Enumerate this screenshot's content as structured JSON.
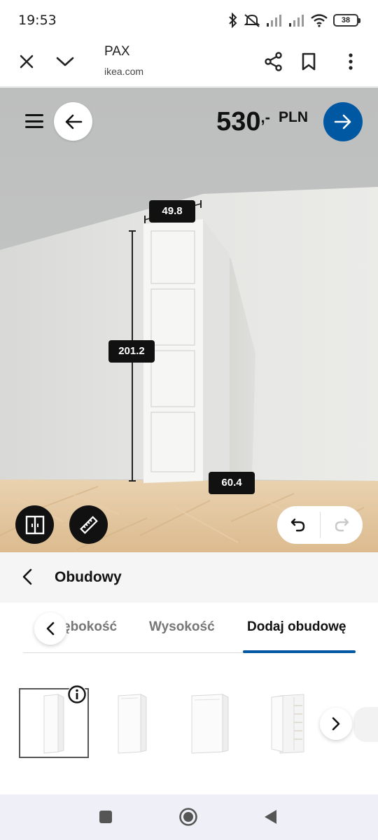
{
  "status_bar": {
    "time": "19:53",
    "battery": "38",
    "icons": [
      "bluetooth-icon",
      "mute-icon",
      "signal-icon",
      "signal-icon",
      "wifi-icon",
      "battery-icon"
    ]
  },
  "browser": {
    "title": "PAX",
    "url": "ikea.com",
    "icons": [
      "close-icon",
      "chevron-down-icon",
      "share-icon",
      "bookmark-icon",
      "more-vertical-icon"
    ]
  },
  "planner": {
    "price_value": "530",
    "price_dash": ",-",
    "price_currency": "PLN",
    "accent_color": "#0058a3",
    "dimensions": {
      "depth": "49.8",
      "height": "201.2",
      "width": "60.4"
    },
    "icons": [
      "menu-icon",
      "arrow-left-icon",
      "arrow-right-icon",
      "doors-icon",
      "ruler-icon",
      "undo-icon",
      "redo-icon"
    ]
  },
  "panel": {
    "title": "Obudowy",
    "tabs": [
      {
        "label": "ębokość",
        "active": false
      },
      {
        "label": "Wysokość",
        "active": false
      },
      {
        "label": "Dodaj obudowę",
        "active": true
      }
    ],
    "products": [
      {
        "name": "wardrobe-frame-narrow",
        "selected": true
      },
      {
        "name": "wardrobe-frame-medium",
        "selected": false
      },
      {
        "name": "wardrobe-frame-wide",
        "selected": false
      },
      {
        "name": "wardrobe-frame-corner",
        "selected": false
      }
    ]
  },
  "nav_bar": {
    "icons": [
      "recents-icon",
      "home-icon",
      "back-icon"
    ]
  }
}
